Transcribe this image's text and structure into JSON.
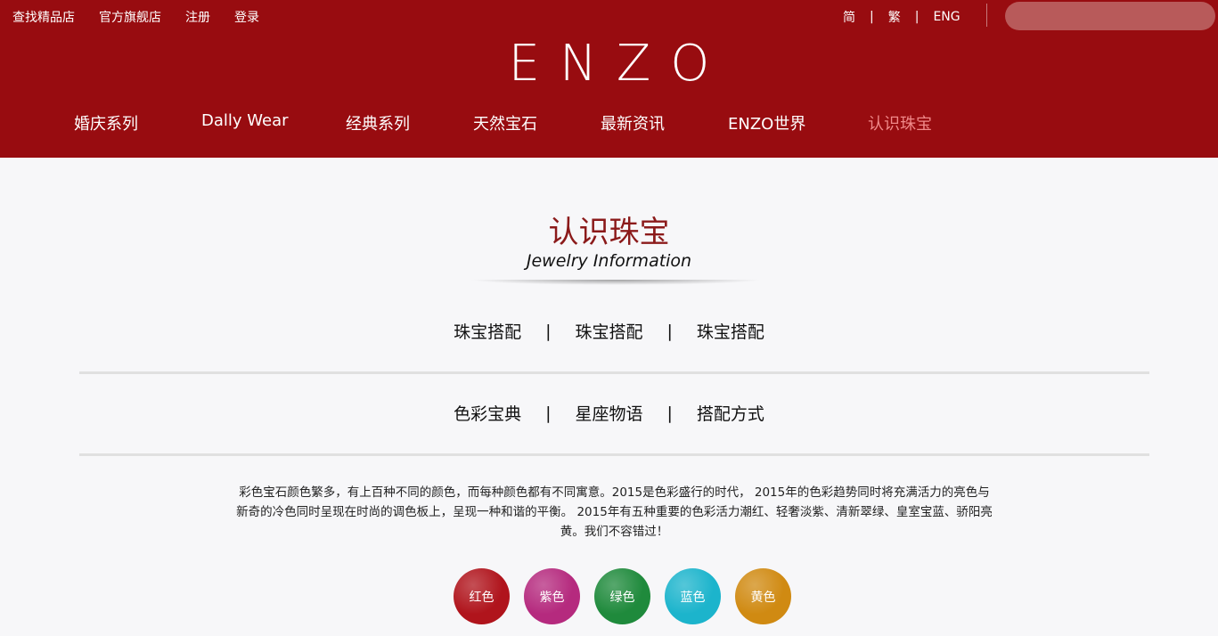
{
  "header": {
    "top_links": [
      "查找精品店",
      "官方旗舰店",
      "注册",
      "登录"
    ],
    "languages": [
      "简",
      "繁",
      "ENG"
    ],
    "language_separator": "|",
    "search": {
      "placeholder": "",
      "value": ""
    },
    "logo": "ENZO",
    "nav": [
      "婚庆系列",
      "Dally Wear",
      "经典系列",
      "天然宝石",
      "最新资讯",
      "ENZO世界",
      "认识珠宝"
    ],
    "active_nav": "认识珠宝"
  },
  "main": {
    "title_cn": "认识珠宝",
    "title_en": "Jewelry Information",
    "tabs_row1": [
      "珠宝搭配",
      "珠宝搭配",
      "珠宝搭配"
    ],
    "tabs_row2": [
      "色彩宝典",
      "星座物语",
      "搭配方式"
    ],
    "separator": "|",
    "description": "彩色宝石颜色繁多，有上百种不同的颜色，而每种颜色都有不同寓意。2015是色彩盛行的时代， 2015年的色彩趋势同时将充满活力的亮色与新奇的冷色同时呈现在时尚的调色板上，呈现一种和谐的平衡。 2015年有五种重要的色彩活力潮红、轻奢淡紫、清新翠绿、皇室宝蓝、骄阳亮黄。我们不容错过！",
    "colors": [
      {
        "label": "红色",
        "color": "#b0141c"
      },
      {
        "label": "紫色",
        "color": "#b52a7e"
      },
      {
        "label": "绿色",
        "color": "#1f8a3c"
      },
      {
        "label": "蓝色",
        "color": "#1cb4cc"
      },
      {
        "label": "黄色",
        "color": "#d08a12"
      }
    ]
  },
  "theme": {
    "brand_red": "#980c10",
    "active_nav_color": "#f08a8a",
    "title_color": "#8b1a1a"
  }
}
